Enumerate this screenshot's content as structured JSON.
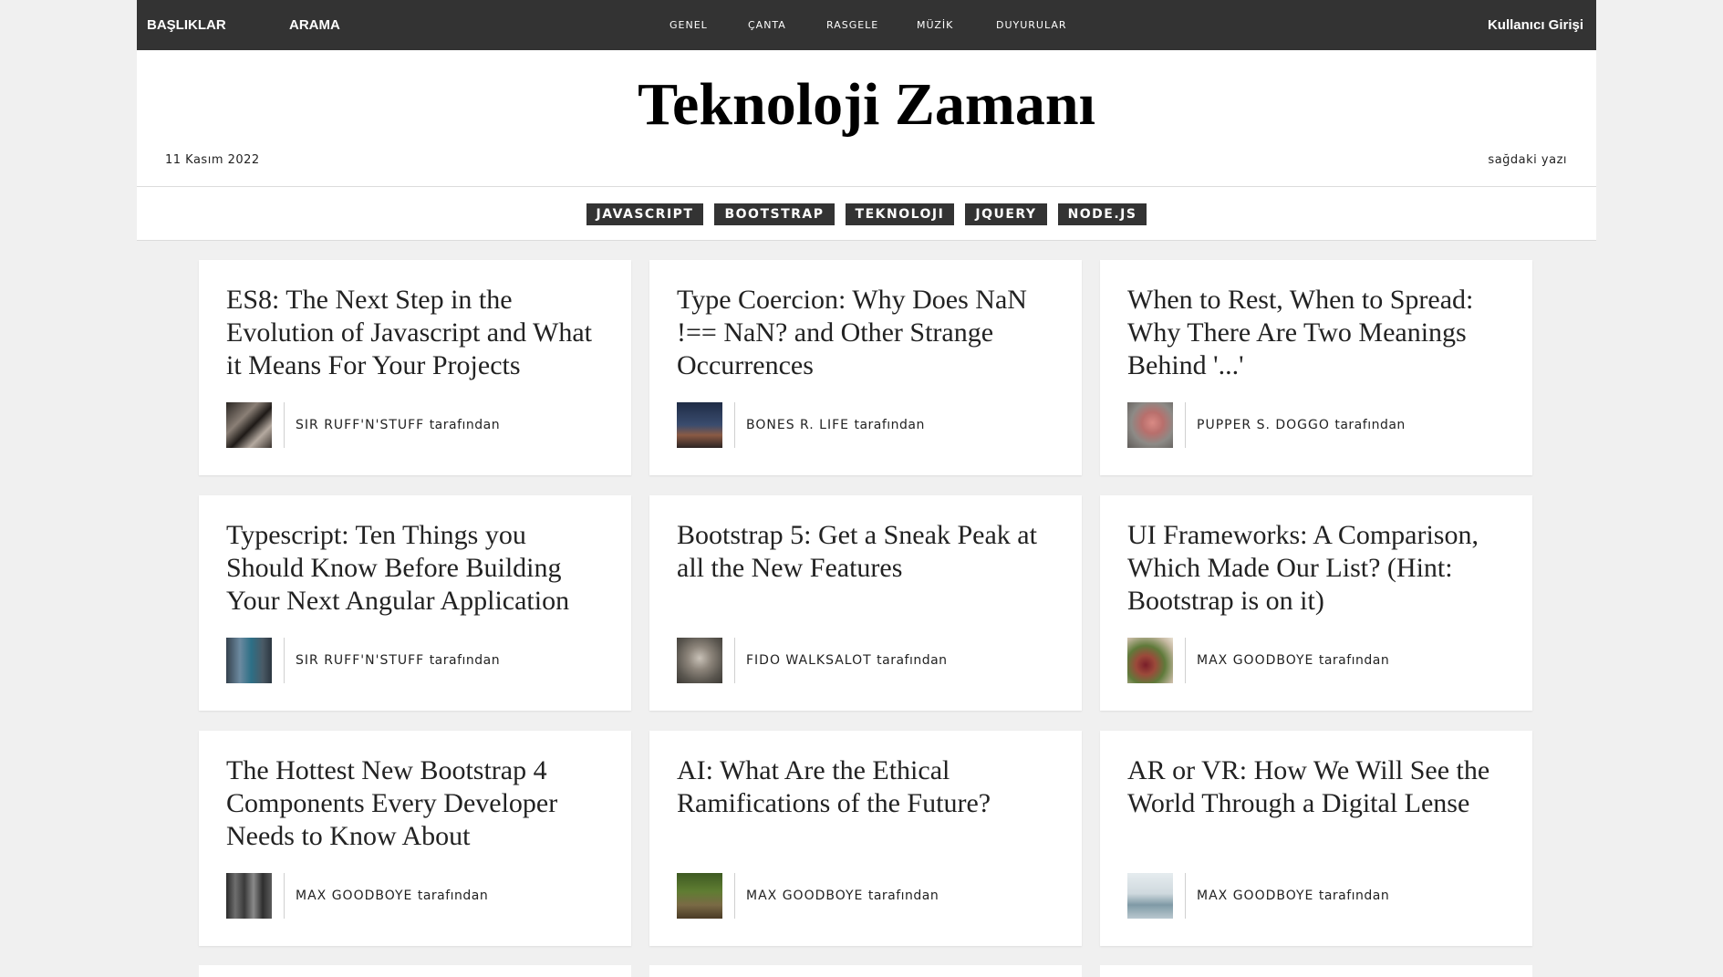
{
  "topbar": {
    "left_items": [
      "BAŞLIKLAR",
      "ARAMA"
    ],
    "nav_items": [
      "GENEL",
      "ÇANTA",
      "RASGELE",
      "MÜZİK",
      "DUYURULAR"
    ],
    "login": "Kullanıcı Girişi"
  },
  "masthead": {
    "title": "Teknoloji Zamanı",
    "date": "11 Kasım 2022",
    "right_text": "sağdaki yazı"
  },
  "tags": [
    "JAVASCRIPT",
    "BOOTSTRAP",
    "TEKNOLOJI",
    "JQUERY",
    "NODE.JS"
  ],
  "byline_suffix": "tarafından",
  "articles": [
    {
      "title": "ES8: The Next Step in the Evolution of Javascript and What it Means For Your Projects",
      "author": "SIR RUFF'N'STUFF"
    },
    {
      "title": "Type Coercion: Why Does NaN !== NaN? and Other Strange Occurrences",
      "author": "BONES R. LIFE"
    },
    {
      "title": "When to Rest, When to Spread: Why There Are Two Meanings Behind '...'",
      "author": "PUPPER S. DOGGO"
    },
    {
      "title": "Typescript: Ten Things you Should Know Before Building Your Next Angular Application",
      "author": "SIR RUFF'N'STUFF"
    },
    {
      "title": "Bootstrap 5: Get a Sneak Peak at all the New Features",
      "author": "FIDO WALKSALOT"
    },
    {
      "title": "UI Frameworks: A Comparison, Which Made Our List? (Hint: Bootstrap is on it)",
      "author": "MAX GOODBOYE"
    },
    {
      "title": "The Hottest New Bootstrap 4 Components Every Developer Needs to Know About",
      "author": "MAX GOODBOYE"
    },
    {
      "title": "AI: What Are the Ethical Ramifications of the Future?",
      "author": "MAX GOODBOYE"
    },
    {
      "title": "AR or VR: How We Will See the World Through a Digital Lense",
      "author": "MAX GOODBOYE"
    }
  ],
  "colors": {
    "bar": "#333333",
    "page_bg": "#f0f0f0",
    "card_bg": "#ffffff",
    "text": "#222222"
  }
}
